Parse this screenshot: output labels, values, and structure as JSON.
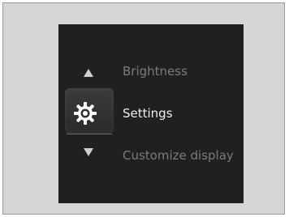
{
  "menu": {
    "items": [
      {
        "label": "Brightness",
        "state": "dim"
      },
      {
        "label": "Settings",
        "state": "selected"
      },
      {
        "label": "Customize display",
        "state": "dim"
      }
    ],
    "icons": {
      "up": "up-arrow-icon",
      "selected": "gear-icon",
      "down": "down-arrow-icon"
    }
  },
  "colors": {
    "screen_bg": "#202020",
    "selected_text": "#f0f0f0",
    "dim_text": "#7b7b7b",
    "frame_bg": "#d6d6d6"
  }
}
